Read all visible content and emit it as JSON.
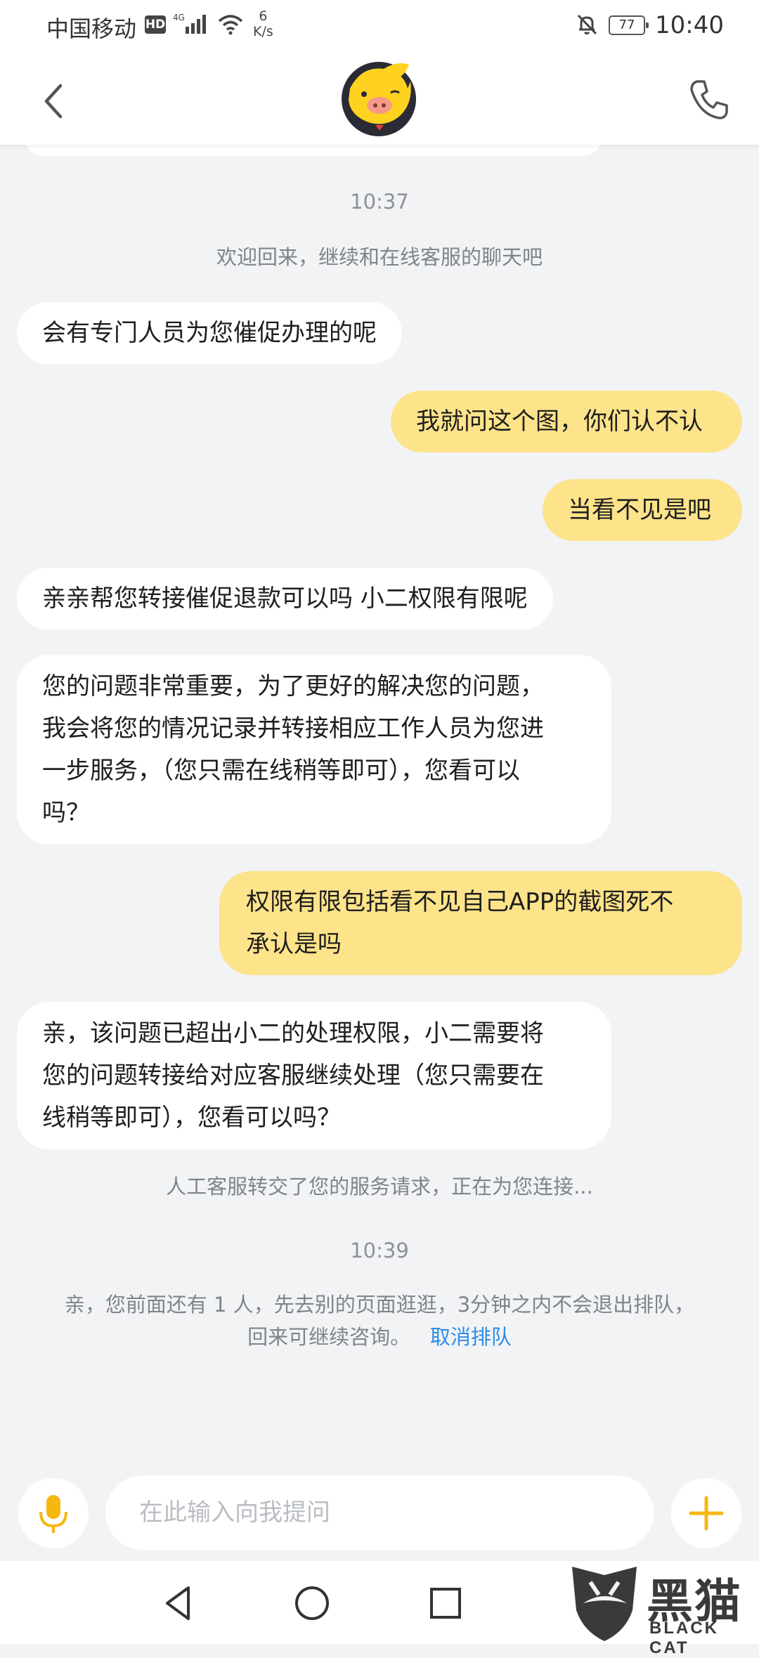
{
  "status_bar": {
    "carrier": "中国移动",
    "hd_badge": "HD",
    "network": "4G",
    "speed_value": "6",
    "speed_unit": "K/s",
    "battery": "77",
    "time": "10:40"
  },
  "header": {
    "back_icon": "chevron-left-icon",
    "avatar": "fliggy-pig-mascot",
    "call_icon": "phone-icon"
  },
  "chat": {
    "time_1": "10:37",
    "welcome": "欢迎回来，继续和在线客服的聊天吧",
    "messages": [
      {
        "side": "in",
        "lines": [
          "会有专门人员为您催促办理的呢"
        ]
      },
      {
        "side": "out",
        "lines": [
          "我就问这个图，你们认不认"
        ]
      },
      {
        "side": "out",
        "lines": [
          "当看不见是吧"
        ]
      },
      {
        "side": "in",
        "lines": [
          "亲亲帮您转接催促退款可以吗 小二权限有限呢"
        ]
      },
      {
        "side": "in",
        "lines": [
          "您的问题非常重要，为了更好的解决您的问题，",
          "我会将您的情况记录并转接相应工作人员为您进",
          "一步服务，（您只需在线稍等即可），您看可以",
          "吗？"
        ]
      },
      {
        "side": "out",
        "lines": [
          "权限有限包括看不见自己APP的截图死不",
          "承认是吗"
        ]
      },
      {
        "side": "in",
        "lines": [
          "亲，该问题已超出小二的处理权限，小二需要将",
          "您的问题转接给对应客服继续处理（您只需要在",
          "线稍等即可），您看可以吗？"
        ]
      }
    ],
    "transfer_notice": "人工客服转交了您的服务请求，正在为您连接...",
    "time_2": "10:39",
    "queue_line_1": "亲，您前面还有 1 人，先去别的页面逛逛，3分钟之内不会退出排队，",
    "queue_line_2": "回来可继续咨询。",
    "cancel_queue": "取消排队"
  },
  "input": {
    "placeholder": "在此输入向我提问",
    "mic_icon": "microphone-icon",
    "plus_icon": "plus-icon"
  },
  "nav": {
    "back": "triangle-back-icon",
    "home": "circle-home-icon",
    "recents": "square-recents-icon"
  },
  "watermark": {
    "main": "黑猫",
    "sub": "BLACK CAT"
  },
  "colors": {
    "incoming_bubble": "#ffffff",
    "outgoing_bubble": "#fde38a",
    "accent_yellow": "#f6b712",
    "link_blue": "#2d8ce8",
    "background": "#f2f3f5"
  }
}
